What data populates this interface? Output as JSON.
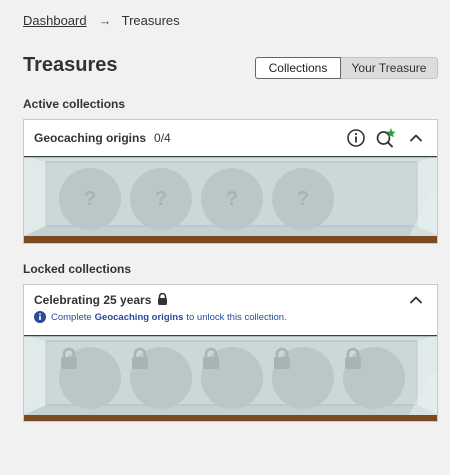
{
  "breadcrumb": {
    "home": "Dashboard",
    "separator": "→",
    "current": "Treasures"
  },
  "page_title": "Treasures",
  "view_toggle": {
    "active": "Collections",
    "inactive": "Your Treasure"
  },
  "active_section": {
    "label": "Active collections",
    "card": {
      "title": "Geocaching origins",
      "count": "0/4",
      "slot_symbol": "?",
      "slots": 4,
      "icons": [
        "info-icon",
        "search-plus-icon",
        "chevron-up-icon"
      ]
    }
  },
  "locked_section": {
    "label": "Locked collections",
    "card": {
      "title": "Celebrating 25 years",
      "info_prefix": "Complete",
      "info_link": "Geocaching origins",
      "info_suffix": "to unlock this collection.",
      "slots": 5,
      "icons": [
        "lock-icon",
        "info-circle-icon",
        "chevron-up-icon"
      ]
    }
  },
  "colors": {
    "page_bg": "#f1f1f1",
    "shelf_glass": "#cfdcdd",
    "shelf_wood": "#7a4a20",
    "info_blue": "#2c4a9a",
    "badge_green": "#2ea043"
  }
}
